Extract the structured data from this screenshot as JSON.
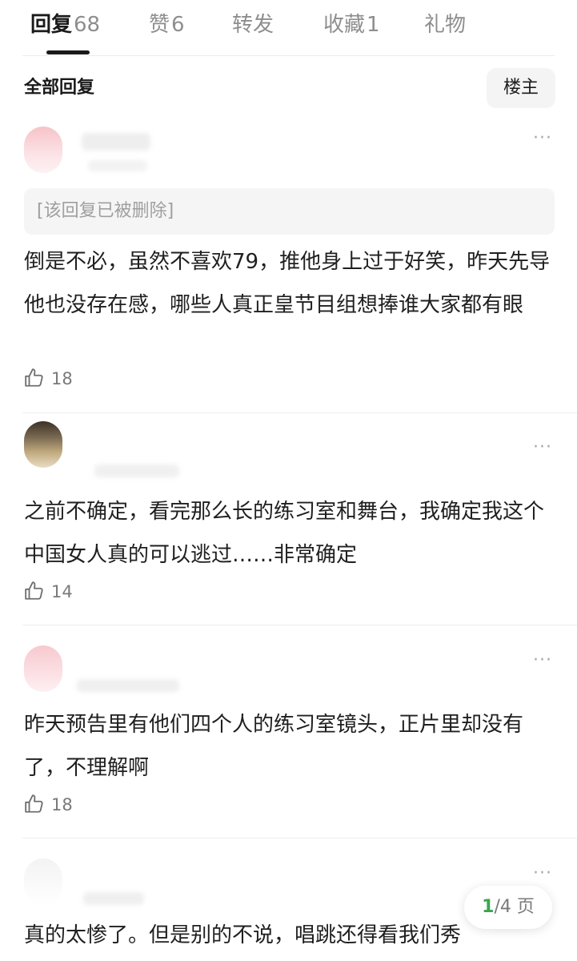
{
  "tabs": [
    {
      "label": "回复",
      "count": "68"
    },
    {
      "label": "赞",
      "count": "6"
    },
    {
      "label": "转发",
      "count": ""
    },
    {
      "label": "收藏",
      "count": "1"
    },
    {
      "label": "礼物",
      "count": ""
    }
  ],
  "section_title": "全部回复",
  "filter_label": "楼主",
  "more_icon": "···",
  "comments": [
    {
      "deleted_note": "[该回复已被删除]",
      "text": "倒是不必，虽然不喜欢79，推他身上过于好笑，昨天先导他也没存在感，哪些人真正皇节目组想捧谁大家都有眼",
      "likes": "18"
    },
    {
      "text": "之前不确定，看完那么长的练习室和舞台，我确定我这个中国女人真的可以逃过……非常确定",
      "likes": "14"
    },
    {
      "text": "昨天预告里有他们四个人的练习室镜头，正片里却没有了，不理解啊",
      "likes": "18"
    },
    {
      "text": "真的太惨了。但是别的不说，唱跳还得看我们秀",
      "likes": ""
    }
  ],
  "pager": {
    "current": "1",
    "total": "/4 页"
  },
  "colors": {
    "accent_green": "#3aa64d",
    "text_primary": "#1f1f1f",
    "text_muted": "#8e8e8e"
  }
}
